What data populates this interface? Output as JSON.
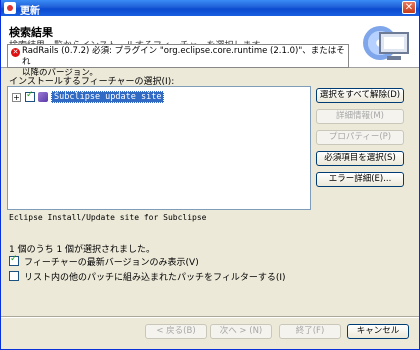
{
  "window": {
    "title": "更新"
  },
  "header": {
    "heading": "検索結果",
    "subtext": "検索結果一覧からインストールするフィーチャーを選択します。",
    "error_line1": "RadRails (0.7.2) 必須: プラグイン \"org.eclipse.core.runtime (2.1.0)\"、またはそれ",
    "error_line2": "以降のバージョン。"
  },
  "features": {
    "label": "インストールするフィーチャーの選択(I):",
    "items": [
      {
        "label": "Subclipse update site",
        "checked": true,
        "expander": "+"
      }
    ]
  },
  "buttons": {
    "deselect_all": "選択をすべて解除(D)",
    "details": "詳細情報(M)",
    "properties": "プロパティー(P)",
    "select_required": "必須項目を選択(S)",
    "error_details": "エラー詳細(E)..."
  },
  "description": "Eclipse Install/Update site for Subclipse",
  "status": {
    "selected_count": "1 個のうち 1 個が選択されました。"
  },
  "options": {
    "latest_only": {
      "label": "フィーチャーの最新バージョンのみ表示(V)",
      "checked": true
    },
    "filter_patches": {
      "label": "リスト内の他のパッチに組み込まれたパッチをフィルターする(I)",
      "checked": false
    }
  },
  "footer": {
    "back": "< 戻る(B)",
    "next": "次へ > (N)",
    "finish": "終了(F)",
    "cancel": "キャンセル"
  }
}
